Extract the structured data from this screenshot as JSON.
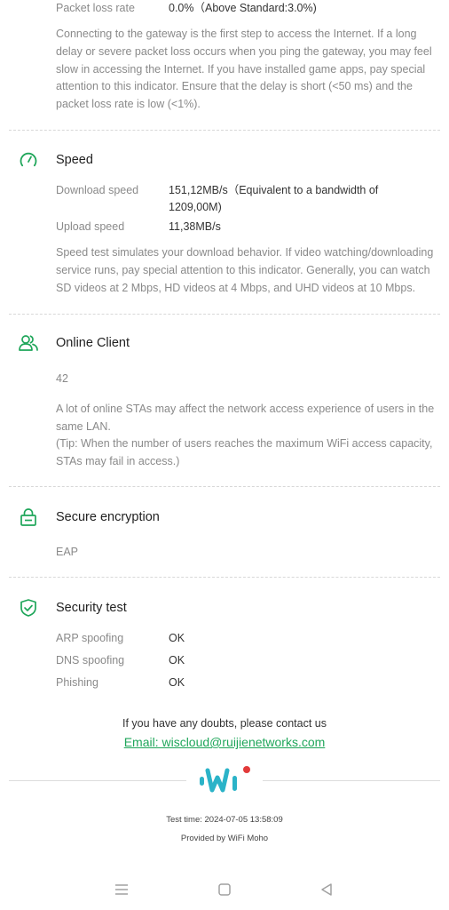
{
  "gateway": {
    "packet_loss_label": "Packet loss rate",
    "packet_loss_value": "0.0%（Above Standard:3.0%)",
    "description": "Connecting to the gateway is the first step to access the Internet. If a long delay or severe packet loss occurs when you ping the gateway, you may feel slow in accessing the Internet. If you have installed game apps, pay special attention to this indicator. Ensure that the delay is short (<50 ms) and the packet loss rate is low (<1%)."
  },
  "speed": {
    "title": "Speed",
    "download_label": "Download speed",
    "download_value": "151,12MB/s（Equivalent to a bandwidth of 1209,00M)",
    "upload_label": "Upload speed",
    "upload_value": "11,38MB/s",
    "description": "Speed test simulates your download behavior. If video watching/downloading service runs, pay special attention to this indicator. Generally, you can watch SD videos at 2 Mbps, HD videos at 4 Mbps, and UHD videos at 10 Mbps."
  },
  "online_client": {
    "title": "Online Client",
    "count": "42",
    "description_line1": "A lot of online STAs may affect the network access experience of users in the same LAN.",
    "description_line2": "(Tip: When the number of users reaches the maximum WiFi access capacity, STAs may fail in access.)"
  },
  "secure_encryption": {
    "title": "Secure encryption",
    "value": "EAP"
  },
  "security_test": {
    "title": "Security test",
    "rows": [
      {
        "label": "ARP spoofing",
        "value": "OK"
      },
      {
        "label": "DNS spoofing",
        "value": "OK"
      },
      {
        "label": "Phishing",
        "value": "OK"
      }
    ]
  },
  "contact": {
    "text": "If you have any doubts, please contact us",
    "email": "Email: wiscloud@ruijienetworks.com"
  },
  "footer": {
    "test_time": "Test time: 2024-07-05 13:58:09",
    "provided_by": "Provided by WiFi Moho"
  },
  "colors": {
    "accent": "#1fa65a",
    "logo_blue": "#2bb3c8",
    "logo_red": "#e23a3a"
  }
}
